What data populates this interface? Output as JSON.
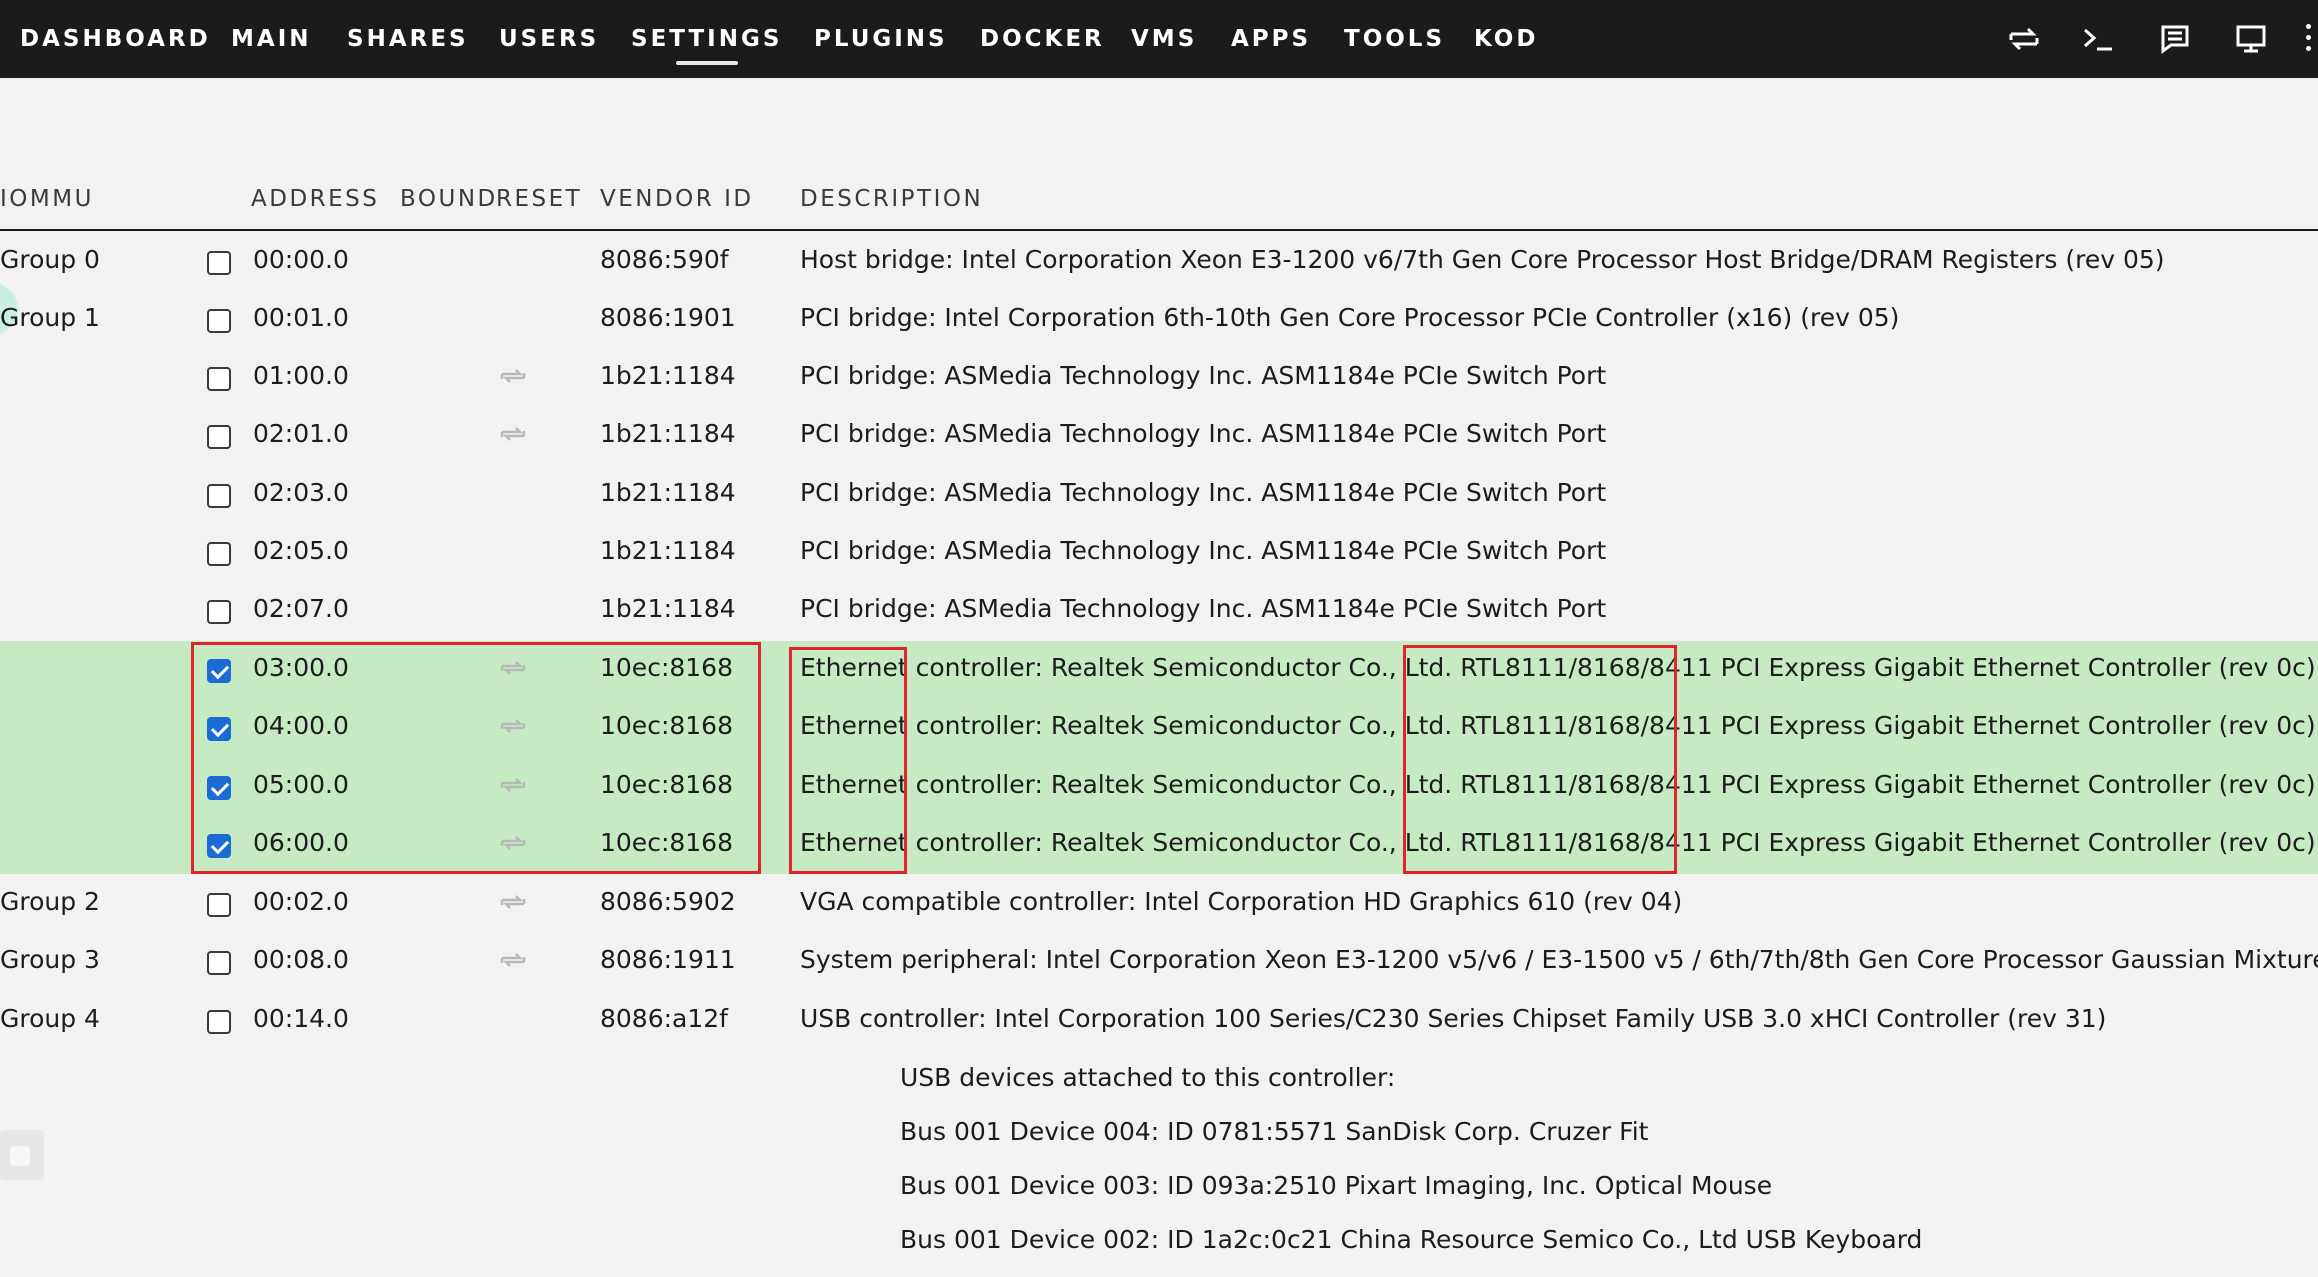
{
  "nav": {
    "items": [
      "DASHBOARD",
      "MAIN",
      "SHARES",
      "USERS",
      "SETTINGS",
      "PLUGINS",
      "DOCKER",
      "VMS",
      "APPS",
      "TOOLS",
      "KOD"
    ],
    "active": "SETTINGS",
    "icons": [
      "transfer-icon",
      "terminal-icon",
      "feedback-icon",
      "monitor-icon",
      "more-icon"
    ]
  },
  "columns": {
    "iommu": "IOMMU",
    "address": "ADDRESS",
    "bound": "BOUND",
    "reset": "RESET",
    "vendor": "VENDOR ID",
    "description": "DESCRIPTION"
  },
  "rows": [
    {
      "group": "Group 0",
      "address": "00:00.0",
      "checked": false,
      "reset": false,
      "vendor": "8086:590f",
      "desc": "Host bridge: Intel Corporation Xeon E3-1200 v6/7th Gen Core Processor Host Bridge/DRAM Registers (rev 05)"
    },
    {
      "group": "Group 1",
      "address": "00:01.0",
      "checked": false,
      "reset": false,
      "vendor": "8086:1901",
      "desc": "PCI bridge: Intel Corporation 6th-10th Gen Core Processor PCIe Controller (x16) (rev 05)"
    },
    {
      "group": "",
      "address": "01:00.0",
      "checked": false,
      "reset": true,
      "vendor": "1b21:1184",
      "desc": "PCI bridge: ASMedia Technology Inc. ASM1184e PCIe Switch Port"
    },
    {
      "group": "",
      "address": "02:01.0",
      "checked": false,
      "reset": true,
      "vendor": "1b21:1184",
      "desc": "PCI bridge: ASMedia Technology Inc. ASM1184e PCIe Switch Port"
    },
    {
      "group": "",
      "address": "02:03.0",
      "checked": false,
      "reset": false,
      "vendor": "1b21:1184",
      "desc": "PCI bridge: ASMedia Technology Inc. ASM1184e PCIe Switch Port"
    },
    {
      "group": "",
      "address": "02:05.0",
      "checked": false,
      "reset": false,
      "vendor": "1b21:1184",
      "desc": "PCI bridge: ASMedia Technology Inc. ASM1184e PCIe Switch Port"
    },
    {
      "group": "",
      "address": "02:07.0",
      "checked": false,
      "reset": false,
      "vendor": "1b21:1184",
      "desc": "PCI bridge: ASMedia Technology Inc. ASM1184e PCIe Switch Port"
    },
    {
      "group": "",
      "address": "03:00.0",
      "checked": true,
      "reset": true,
      "vendor": "10ec:8168",
      "desc": "Ethernet controller: Realtek Semiconductor Co., Ltd. RTL8111/8168/8411 PCI Express Gigabit Ethernet Controller (rev 0c)"
    },
    {
      "group": "",
      "address": "04:00.0",
      "checked": true,
      "reset": true,
      "vendor": "10ec:8168",
      "desc": "Ethernet controller: Realtek Semiconductor Co., Ltd. RTL8111/8168/8411 PCI Express Gigabit Ethernet Controller (rev 0c)"
    },
    {
      "group": "",
      "address": "05:00.0",
      "checked": true,
      "reset": true,
      "vendor": "10ec:8168",
      "desc": "Ethernet controller: Realtek Semiconductor Co., Ltd. RTL8111/8168/8411 PCI Express Gigabit Ethernet Controller (rev 0c)"
    },
    {
      "group": "",
      "address": "06:00.0",
      "checked": true,
      "reset": true,
      "vendor": "10ec:8168",
      "desc": "Ethernet controller: Realtek Semiconductor Co., Ltd. RTL8111/8168/8411 PCI Express Gigabit Ethernet Controller (rev 0c)"
    },
    {
      "group": "Group 2",
      "address": "00:02.0",
      "checked": false,
      "reset": true,
      "vendor": "8086:5902",
      "desc": "VGA compatible controller: Intel Corporation HD Graphics 610 (rev 04)"
    },
    {
      "group": "Group 3",
      "address": "00:08.0",
      "checked": false,
      "reset": true,
      "vendor": "8086:1911",
      "desc": "System peripheral: Intel Corporation Xeon E3-1200 v5/v6 / E3-1500 v5 / 6th/7th/8th Gen Core Processor Gaussian Mixture Model"
    },
    {
      "group": "Group 4",
      "address": "00:14.0",
      "checked": false,
      "reset": false,
      "vendor": "8086:a12f",
      "desc": "USB controller: Intel Corporation 100 Series/C230 Series Chipset Family USB 3.0 xHCI Controller (rev 31)"
    }
  ],
  "usb": {
    "heading": "USB devices attached to this controller:",
    "devices": [
      "Bus 001 Device 004: ID 0781:5571 SanDisk Corp. Cruzer Fit",
      "Bus 001 Device 003: ID 093a:2510 Pixart Imaging, Inc. Optical Mouse",
      "Bus 001 Device 002: ID 1a2c:0c21 China Resource Semico Co., Ltd USB Keyboard"
    ]
  },
  "colors": {
    "highlight": "#c6ebc3",
    "annotation": "#e0242b",
    "checkbox_checked": "#1a6bd4"
  }
}
